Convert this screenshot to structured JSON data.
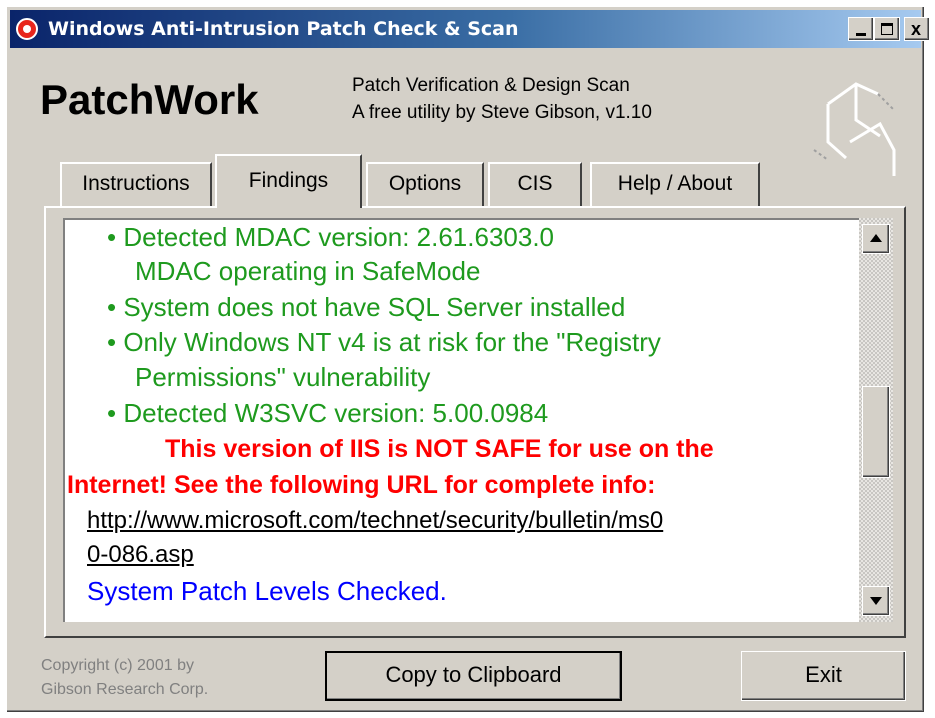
{
  "window": {
    "title": "Windows Anti-Intrusion Patch Check & Scan",
    "controls": {
      "minimize": "",
      "maximize": "",
      "close": "x"
    }
  },
  "header": {
    "logo": "PatchWork",
    "subtitle_line1": "Patch Verification & Design Scan",
    "subtitle_line2": "A free utility by Steve Gibson, v1.10"
  },
  "tabs": [
    {
      "label": "Instructions",
      "active": false
    },
    {
      "label": "Findings",
      "active": true
    },
    {
      "label": "Options",
      "active": false
    },
    {
      "label": "CIS",
      "active": false
    },
    {
      "label": "Help / About",
      "active": false
    }
  ],
  "findings": {
    "lines": [
      {
        "text": "• Detected MDAC version: 2.61.6303.0",
        "style": "green"
      },
      {
        "text": "MDAC operating in SafeMode",
        "style": "green"
      },
      {
        "text": "• System does not have SQL Server installed",
        "style": "green"
      },
      {
        "text": "• Only Windows NT v4 is at risk for the \"Registry",
        "style": "green"
      },
      {
        "text": "Permissions\" vulnerability",
        "style": "green"
      },
      {
        "text": "• Detected W3SVC version: 5.00.0984",
        "style": "green"
      },
      {
        "text": "This version of IIS is NOT SAFE for use on the",
        "style": "red"
      },
      {
        "text": "Internet! See the following URL for complete info:",
        "style": "red"
      },
      {
        "text": "http://www.microsoft.com/technet/security/bulletin/ms0",
        "style": "link"
      },
      {
        "text": "0-086.asp",
        "style": "link"
      },
      {
        "text": "System Patch Levels Checked.",
        "style": "blue"
      }
    ]
  },
  "scrollbar": {
    "position_fraction": 0.55
  },
  "footer": {
    "copyright_line1": "Copyright (c) 2001 by",
    "copyright_line2": "Gibson Research Corp.",
    "copy_button": "Copy to Clipboard",
    "exit_button": "Exit"
  },
  "colors": {
    "title_gradient_start": "#0a246a",
    "title_gradient_end": "#a6caf0",
    "ok_text": "#1e9a1e",
    "alert_text": "#ff0000",
    "status_text": "#0000ff",
    "window_face": "#d4d0c8"
  }
}
